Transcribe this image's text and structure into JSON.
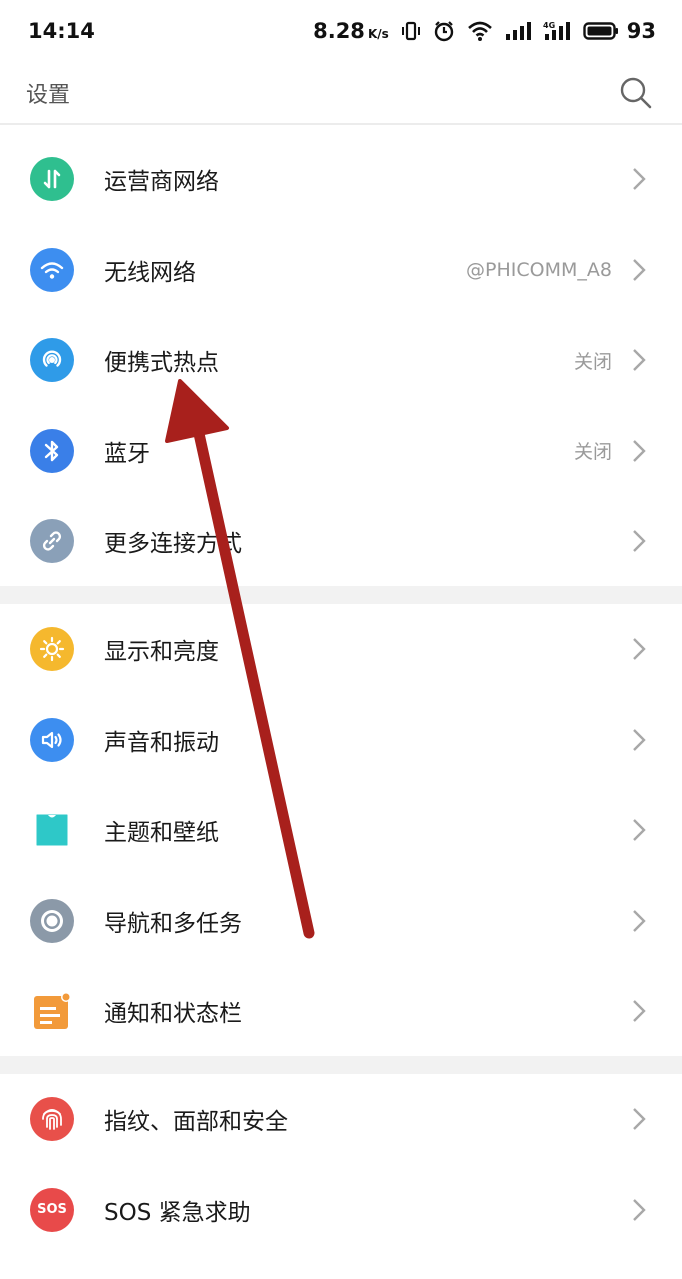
{
  "status_bar": {
    "time": "14:14",
    "net_speed": "8.28",
    "net_speed_unit": "K/s",
    "battery": "93"
  },
  "header": {
    "title": "设置"
  },
  "groups": [
    {
      "items": [
        {
          "label": "运营商网络",
          "value": "",
          "icon": "carrier-network-icon",
          "color": "#2fbf8f"
        },
        {
          "label": "无线网络",
          "value": "@PHICOMM_A8",
          "icon": "wifi-icon",
          "color": "#3d8ef0"
        },
        {
          "label": "便携式热点",
          "value": "关闭",
          "icon": "hotspot-icon",
          "color": "#2f9be8"
        },
        {
          "label": "蓝牙",
          "value": "关闭",
          "icon": "bluetooth-icon",
          "color": "#3a7fe8"
        },
        {
          "label": "更多连接方式",
          "value": "",
          "icon": "link-icon",
          "color": "#8aa0b8"
        }
      ]
    },
    {
      "items": [
        {
          "label": "显示和亮度",
          "value": "",
          "icon": "brightness-icon",
          "color": "#f5b82e"
        },
        {
          "label": "声音和振动",
          "value": "",
          "icon": "sound-icon",
          "color": "#3d8ef0"
        },
        {
          "label": "主题和壁纸",
          "value": "",
          "icon": "theme-icon",
          "color": "#2ec8c8"
        },
        {
          "label": "导航和多任务",
          "value": "",
          "icon": "navigation-icon",
          "color": "#8b99a8"
        },
        {
          "label": "通知和状态栏",
          "value": "",
          "icon": "notification-icon",
          "color": "#f29a3a"
        }
      ]
    },
    {
      "items": [
        {
          "label": "指纹、面部和安全",
          "value": "",
          "icon": "fingerprint-icon",
          "color": "#e8504a"
        },
        {
          "label": "SOS 紧急求助",
          "value": "",
          "icon": "sos-icon",
          "color": "#e84a4a"
        }
      ]
    }
  ],
  "sos_icon_text": "SOS"
}
